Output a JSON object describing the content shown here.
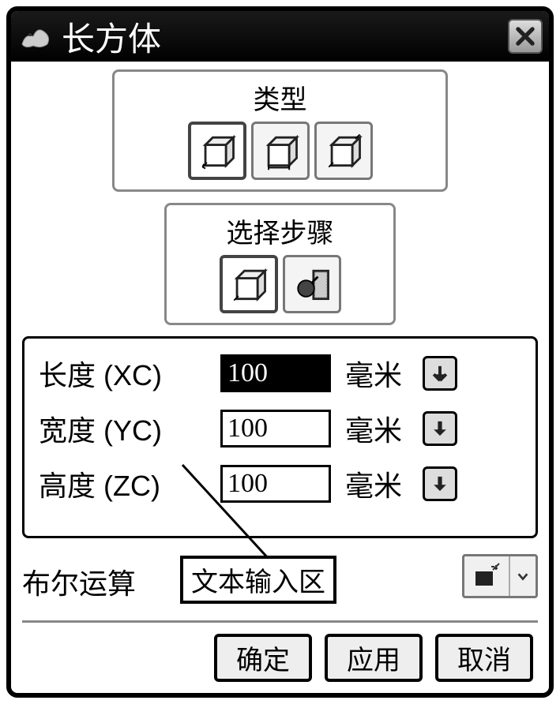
{
  "title": "长方体",
  "group_type_label": "类型",
  "group_step_label": "选择步骤",
  "params": {
    "length_label": "长度 (XC)",
    "length_value": "100",
    "length_unit": "毫米",
    "width_label": "宽度 (YC)",
    "width_value": "100",
    "width_unit": "毫米",
    "height_label": "高度 (ZC)",
    "height_value": "100",
    "height_unit": "毫米"
  },
  "boolean_label": "布尔运算",
  "annotation_text": "文本输入区",
  "buttons": {
    "ok": "确定",
    "apply": "应用",
    "cancel": "取消"
  }
}
